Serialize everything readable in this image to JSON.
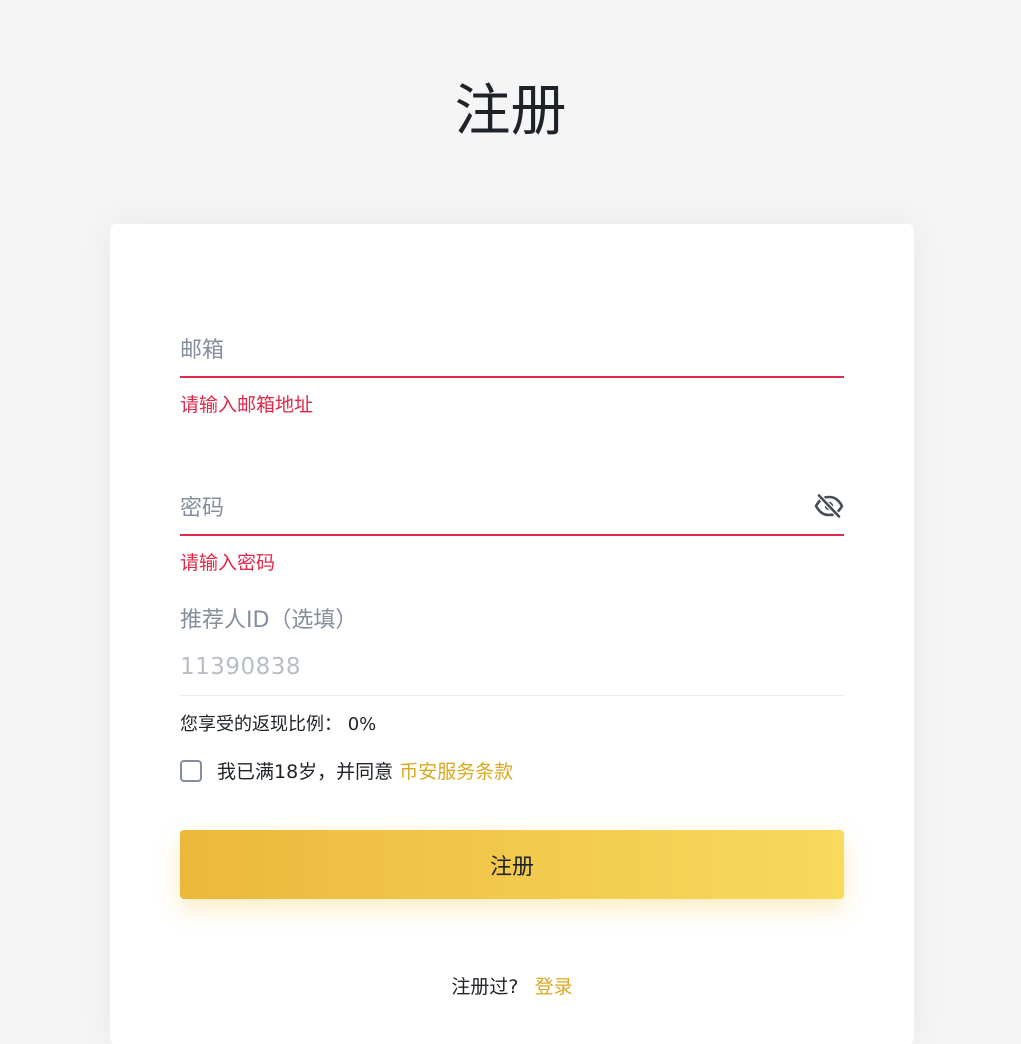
{
  "page": {
    "title": "注册"
  },
  "form": {
    "email": {
      "placeholder": "邮箱",
      "error": "请输入邮箱地址"
    },
    "password": {
      "placeholder": "密码",
      "error": "请输入密码",
      "toggle_icon": "eye-off-icon"
    },
    "referral": {
      "label": "推荐人ID（选填）",
      "value": "11390838"
    },
    "rebate": {
      "label": "您享受的返现比例：",
      "value": "0%"
    },
    "agreement": {
      "text": "我已满18岁，并同意",
      "link": "币安服务条款",
      "checked": false
    },
    "submit_label": "注册"
  },
  "footer": {
    "question": "注册过?",
    "login_link": "登录"
  },
  "colors": {
    "error": "#e0294a",
    "accent": "#d9a91f",
    "button_gradient_start": "#ebb83b",
    "button_gradient_end": "#f8da5d"
  }
}
